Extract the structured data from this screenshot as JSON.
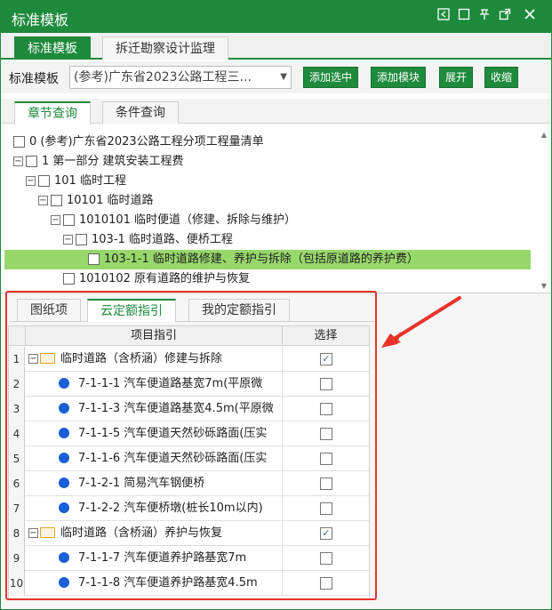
{
  "window": {
    "title": "标准模板",
    "controls": [
      "pin-left",
      "maximize",
      "pin",
      "popout",
      "close"
    ]
  },
  "main_tabs": [
    {
      "label": "标准模板",
      "active": true
    },
    {
      "label": "拆迁勘察设计监理",
      "active": false
    }
  ],
  "toolbar": {
    "label": "标准模板",
    "template_select": "(参考)广东省2023公路工程三...",
    "add_selected": "添加选中",
    "add_module": "添加模块",
    "expand": "展开",
    "collapse": "收缩"
  },
  "chapter_tabs": [
    {
      "label": "章节查询",
      "active": true
    },
    {
      "label": "条件查询",
      "active": false
    }
  ],
  "tree": [
    {
      "label": "0 (参考)广东省2023公路工程分项工程量清单",
      "level": 0,
      "expander": "",
      "selected": false
    },
    {
      "label": "1 第一部分 建筑安装工程费",
      "level": 0,
      "expander": "−",
      "selected": false
    },
    {
      "label": "101 临时工程",
      "level": 1,
      "expander": "−",
      "selected": false
    },
    {
      "label": "10101 临时道路",
      "level": 2,
      "expander": "−",
      "selected": false
    },
    {
      "label": "1010101 临时便道（修建、拆除与维护）",
      "level": 3,
      "expander": "−",
      "selected": false
    },
    {
      "label": "103-1 临时道路、便桥工程",
      "level": 4,
      "expander": "−",
      "selected": false
    },
    {
      "label": "103-1-1 临时道路修建、养护与拆除（包括原道路的养护费）",
      "level": 5,
      "expander": "",
      "selected": true
    },
    {
      "label": "1010102 原有道路的维护与恢复",
      "level": 3,
      "expander": "",
      "selected": false
    }
  ],
  "bottom_tabs": [
    {
      "label": "图纸项",
      "active": false
    },
    {
      "label": "云定额指引",
      "active": true
    },
    {
      "label": "我的定额指引",
      "active": false
    }
  ],
  "grid": {
    "headers": {
      "item": "项目指引",
      "select": "选择"
    },
    "rows": [
      {
        "num": "1",
        "type": "group",
        "text": "临时道路（含桥涵）修建与拆除",
        "checked": true
      },
      {
        "num": "2",
        "type": "item",
        "text": "7-1-1-1 汽车便道路基宽7m(平原微",
        "checked": false
      },
      {
        "num": "3",
        "type": "item",
        "text": "7-1-1-3 汽车便道路基宽4.5m(平原微",
        "checked": false
      },
      {
        "num": "4",
        "type": "item",
        "text": "7-1-1-5 汽车便道天然砂砾路面(压实",
        "checked": false
      },
      {
        "num": "5",
        "type": "item",
        "text": "7-1-1-6 汽车便道天然砂砾路面(压实",
        "checked": false
      },
      {
        "num": "6",
        "type": "item",
        "text": "7-1-2-1 简易汽车钢便桥",
        "checked": false
      },
      {
        "num": "7",
        "type": "item",
        "text": "7-1-2-2 汽车便桥墩(桩长10m以内)",
        "checked": false
      },
      {
        "num": "8",
        "type": "group",
        "text": "临时道路（含桥涵）养护与恢复",
        "checked": true
      },
      {
        "num": "9",
        "type": "item",
        "text": "7-1-1-7 汽车便道养护路基宽7m",
        "checked": false
      },
      {
        "num": "10",
        "type": "item",
        "text": "7-1-1-8 汽车便道养护路基宽4.5m",
        "checked": false
      }
    ]
  },
  "colors": {
    "brand_green": "#1e8a3c",
    "selected_row": "#97d86b",
    "highlight_red": "#e8332a",
    "bullet_blue": "#1a5fd6"
  }
}
